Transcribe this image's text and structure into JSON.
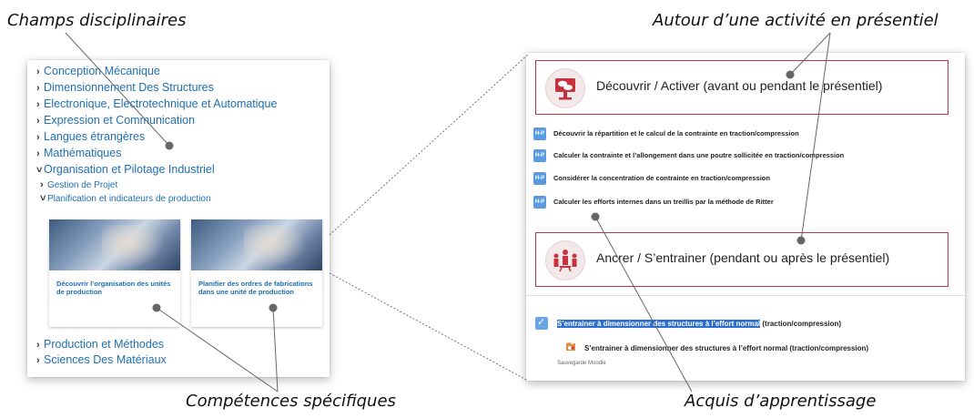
{
  "callouts": {
    "champs": "Champs disciplinaires",
    "autour": "Autour d’une activité en présentiel",
    "competences": "Compétences spécifiques",
    "acquis": "Acquis d’apprentissage"
  },
  "tree": [
    {
      "label": "Conception Mécanique",
      "caret": "›"
    },
    {
      "label": "Dimensionnement Des Structures",
      "caret": "›"
    },
    {
      "label": "Electronique, Electrotechnique et Automatique",
      "caret": "›"
    },
    {
      "label": "Expression et Communication",
      "caret": "›"
    },
    {
      "label": "Langues étrangères",
      "caret": "›"
    },
    {
      "label": "Mathématiques",
      "caret": "›"
    },
    {
      "label": "Organisation et Pilotage Industriel",
      "caret": "˅"
    }
  ],
  "subtree": [
    {
      "label": "Gestion de Projet",
      "caret": "›"
    },
    {
      "label": "Planification et indicateurs de production",
      "caret": "˅"
    }
  ],
  "cards": [
    {
      "title": "Découvrir l’organisation des unités de production"
    },
    {
      "title": "Planifier des ordres de fabrications dans une unité de production"
    }
  ],
  "tree_bottom": [
    {
      "label": "Production et Méthodes",
      "caret": "›"
    },
    {
      "label": "Sciences Des Matériaux",
      "caret": "›"
    }
  ],
  "sections": {
    "decouvrir": "Découvrir / Activer (avant ou pendant le présentiel)",
    "ancrer": "Ancrer / S’entrainer (pendant ou après le présentiel)"
  },
  "h5p_label": "H-P",
  "activities": [
    "Découvrir la répartition et le calcul de la contrainte en traction/compression",
    "Calculer la contrainte et l’allongement dans une poutre sollicitée en traction/compression",
    "Considérer la concentration de contrainte en traction/compression",
    "Calculer les efforts internes dans un treillis par la méthode de Ritter"
  ],
  "acquis": {
    "highlight": "S’entrainer à dimensionner des structures à l’effort normal",
    "rest": " (traction/compression)",
    "backup": "S’entrainer à dimensionner des structures à l’effort normal (traction/compression)",
    "backup_label": "Sauvegarde Moodle"
  },
  "colors": {
    "link": "#1f6fb2",
    "section_border": "#b23a48",
    "h5p": "#5a9be0",
    "highlight": "#2a6fd0"
  }
}
